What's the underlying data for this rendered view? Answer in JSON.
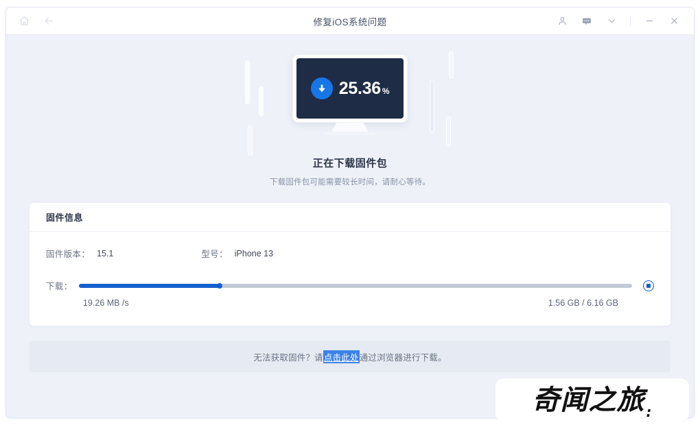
{
  "window": {
    "title": "修复iOS系统问题",
    "nav": {
      "home_icon": "home-icon",
      "back_icon": "back-arrow-icon"
    },
    "controls": {
      "account_icon": "person-icon",
      "feedback_icon": "message-bubble-icon",
      "chevron_icon": "chevron-down-icon",
      "minimize_icon": "minimize-icon",
      "close_icon": "close-icon"
    }
  },
  "hero": {
    "percent_value": "25.36",
    "percent_symbol": "%",
    "download_icon": "download-arrow-icon",
    "title": "正在下载固件包",
    "subtitle": "下载固件包可能需要较长时间，请耐心等待。"
  },
  "card": {
    "header": "固件信息",
    "firmware_version_label": "固件版本：",
    "firmware_version_value": "15.1",
    "model_label": "型号：",
    "model_value": "iPhone 13",
    "download_label": "下载：",
    "speed": "19.26 MB /s",
    "size": "1.56 GB / 6.16 GB",
    "progress_percent": "25.36",
    "stop_icon": "stop-button-icon"
  },
  "footer": {
    "prefix": "无法获取固件？请",
    "link": "点击此处",
    "suffix": "通过浏览器进行下载。"
  },
  "watermark": {
    "text": "奇闻之旅",
    "tail": ":"
  },
  "colors": {
    "accent": "#1560d0",
    "badge": "#1677e8",
    "screen": "#1e2c46",
    "page_bg": "#eef1f8",
    "link_bg": "#3b82e8"
  }
}
